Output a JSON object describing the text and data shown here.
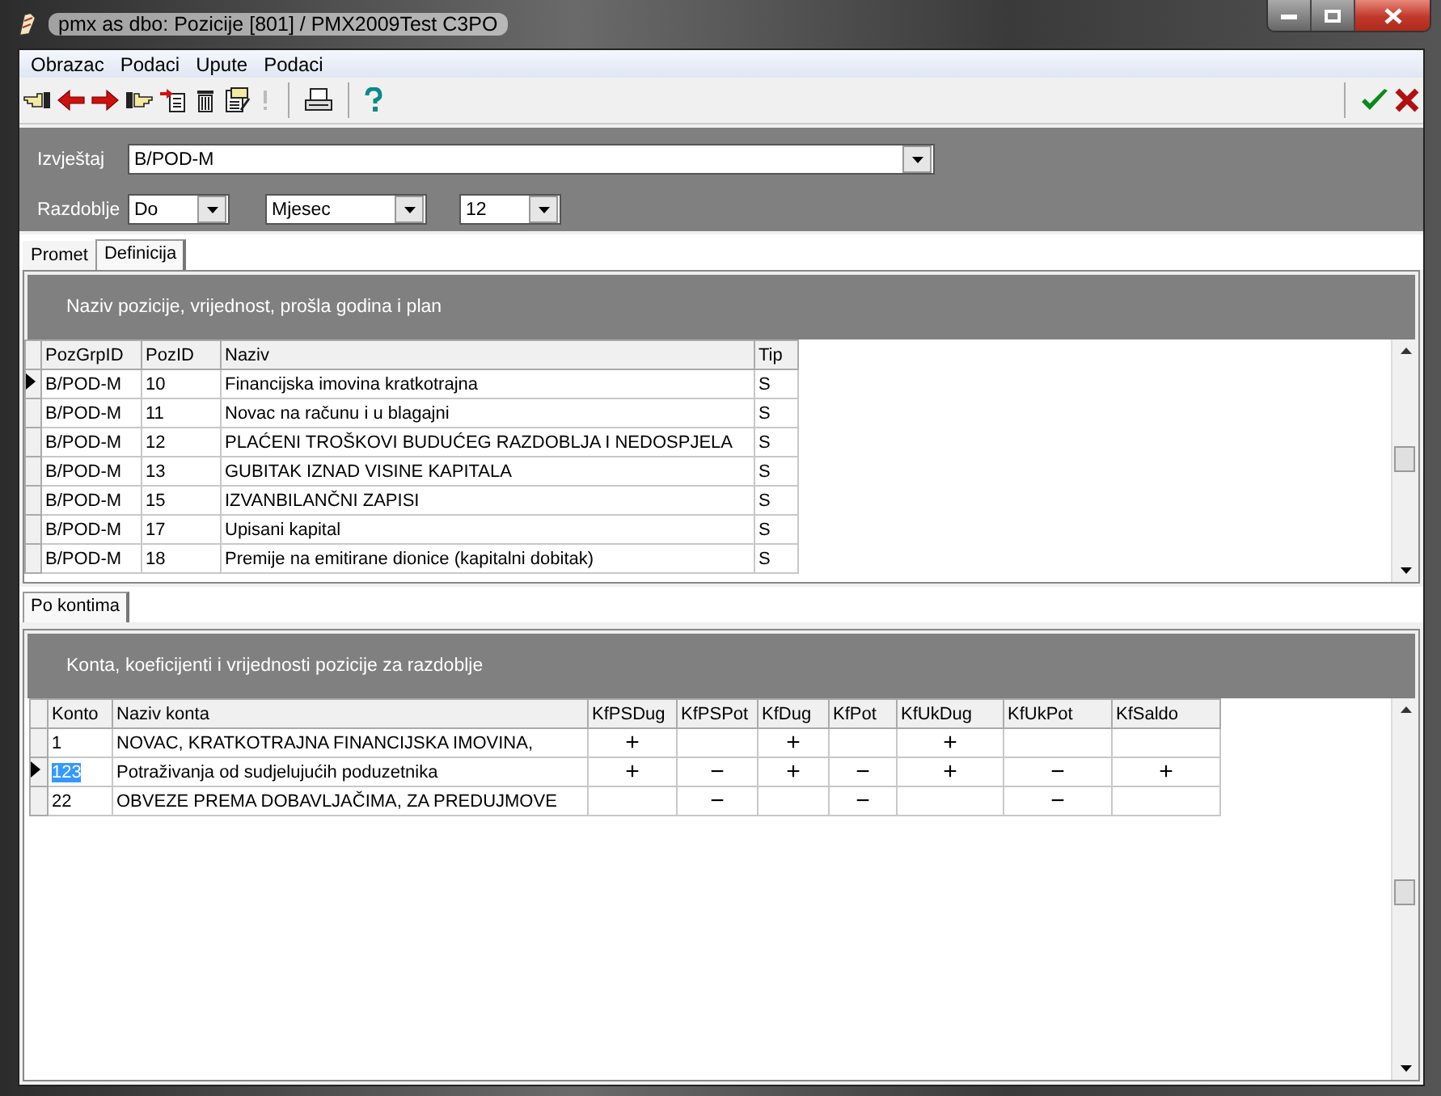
{
  "window": {
    "title": "pmx as dbo: Pozicije [801] / PMX2009Test C3PO"
  },
  "menu": [
    "Obrazac",
    "Podaci",
    "Upute",
    "Podaci"
  ],
  "report": {
    "label": "Izvještaj",
    "value": "B/POD-M"
  },
  "period": {
    "label": "Razdoblje",
    "fields": [
      "Do",
      "Mjesec",
      "12"
    ]
  },
  "tabs": [
    {
      "label": "Promet",
      "selected": false
    },
    {
      "label": "Definicija",
      "selected": true
    }
  ],
  "positions": {
    "title": "Naziv pozicije, vrijednost, prošla godina i plan",
    "columns": [
      "PozGrpID",
      "PozID",
      "Naziv",
      "Tip"
    ],
    "rows": [
      {
        "cells": [
          "B/POD-M",
          "10",
          "Financijska imovina kratkotrajna",
          "S"
        ],
        "selected": true
      },
      {
        "cells": [
          "B/POD-M",
          "11",
          "Novac na računu i u blagajni",
          "S"
        ],
        "selected": false
      },
      {
        "cells": [
          "B/POD-M",
          "12",
          "PLAĆENI TROŠKOVI BUDUĆEG RAZDOBLJA I NEDOSPJELA",
          "S"
        ],
        "selected": false
      },
      {
        "cells": [
          "B/POD-M",
          "13",
          "GUBITAK IZNAD VISINE KAPITALA",
          "S"
        ],
        "selected": false
      },
      {
        "cells": [
          "B/POD-M",
          "15",
          "IZVANBILANČNI ZAPISI",
          "S"
        ],
        "selected": false
      },
      {
        "cells": [
          "B/POD-M",
          "17",
          "Upisani kapital",
          "S"
        ],
        "selected": false
      },
      {
        "cells": [
          "B/POD-M",
          "18",
          "Premije na emitirane dionice (kapitalni dobitak)",
          "S"
        ],
        "selected": false
      }
    ]
  },
  "sub_tabs": [
    {
      "label": "Po kontima",
      "selected": true
    }
  ],
  "accounts": {
    "title": "Konta, koeficijenti i vrijednosti pozicije za razdoblje",
    "columns": [
      "Konto",
      "Naziv konta",
      "KfPSDug",
      "KfPSPot",
      "KfDug",
      "KfPot",
      "KfUkDug",
      "KfUkPot",
      "KfSaldo"
    ],
    "rows": [
      {
        "konto": "1",
        "naziv": "NOVAC, KRATKOTRAJNA FINANCIJSKA IMOVINA,",
        "coefficients": [
          {
            "kind": "sign",
            "text": "+"
          },
          {
            "kind": "blank"
          },
          {
            "kind": "sign",
            "text": "+"
          },
          {
            "kind": "blank"
          },
          {
            "kind": "sign",
            "text": "+"
          },
          {
            "kind": "blank"
          },
          {
            "kind": "blank"
          }
        ],
        "selected": false
      },
      {
        "konto": "123",
        "naziv": "Potraživanja od sudjelujućih poduzetnika",
        "coefficients": [
          {
            "kind": "sign",
            "text": "+"
          },
          {
            "kind": "sign",
            "text": "−"
          },
          {
            "kind": "sign",
            "text": "+"
          },
          {
            "kind": "sign",
            "text": "−"
          },
          {
            "kind": "sign",
            "text": "+"
          },
          {
            "kind": "sign",
            "text": "−"
          },
          {
            "kind": "sign",
            "text": "+"
          }
        ],
        "selected": true
      },
      {
        "konto": "22",
        "naziv": "OBVEZE PREMA DOBAVLJAČIMA, ZA PREDUJMOVE",
        "coefficients": [
          {
            "kind": "blank"
          },
          {
            "kind": "sign",
            "text": "−"
          },
          {
            "kind": "blank"
          },
          {
            "kind": "sign",
            "text": "−"
          },
          {
            "kind": "blank"
          },
          {
            "kind": "sign",
            "text": "−"
          },
          {
            "kind": "blank"
          }
        ],
        "selected": false
      }
    ]
  }
}
